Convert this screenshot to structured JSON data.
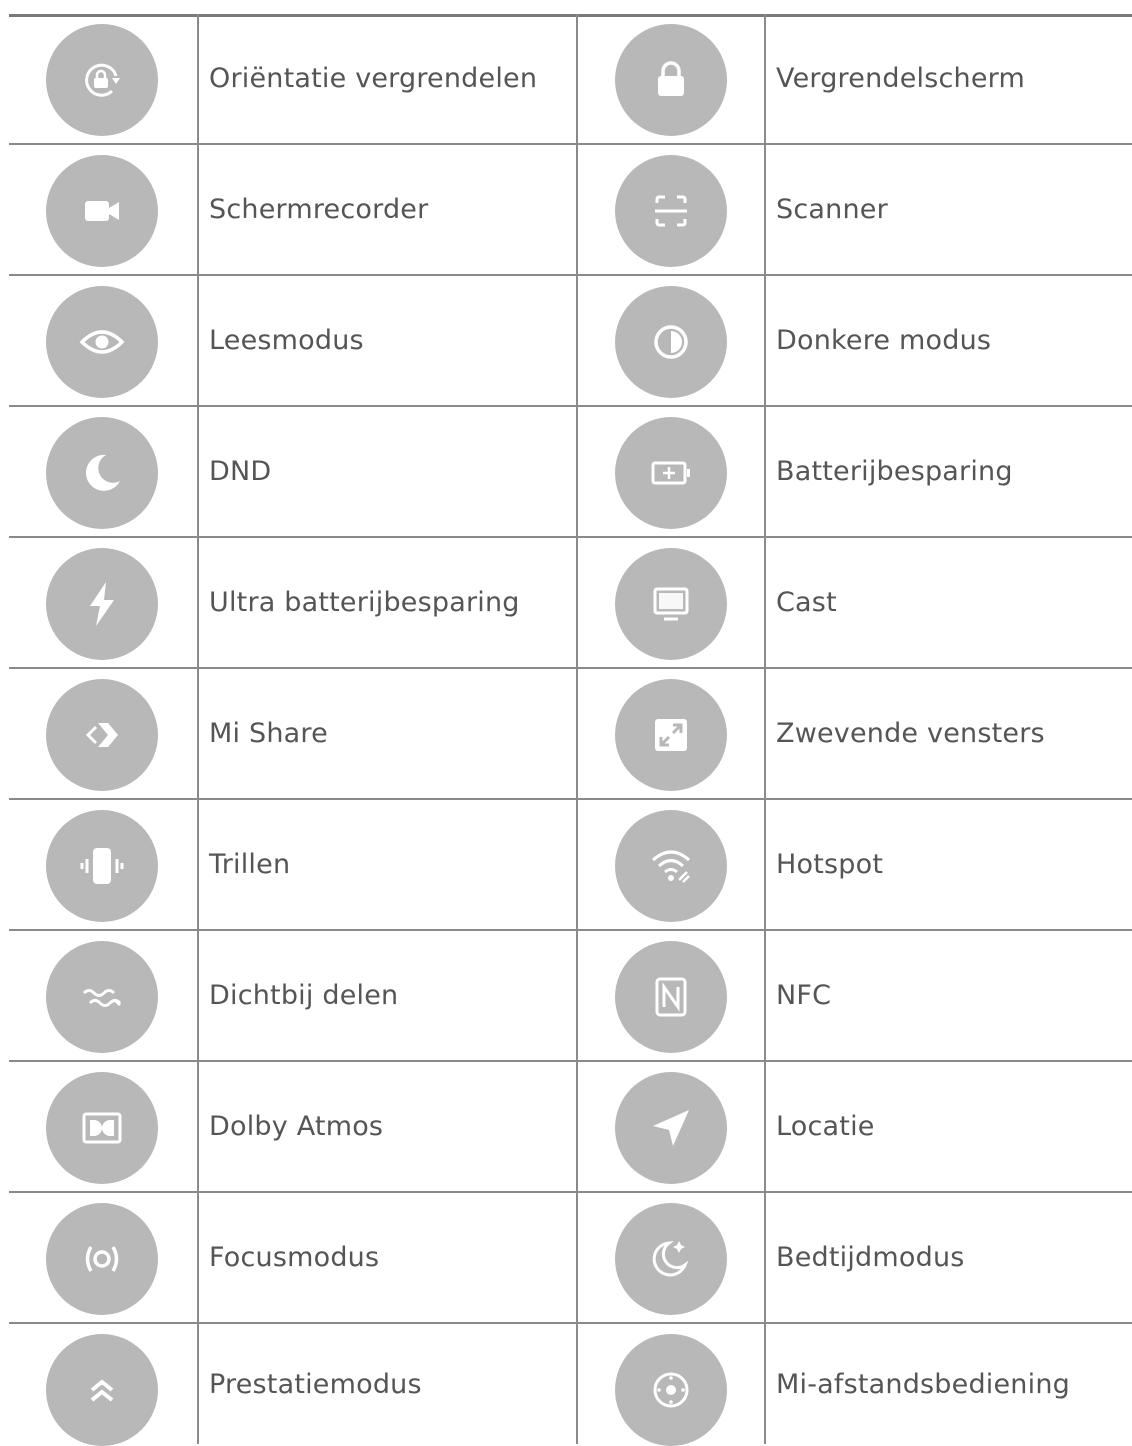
{
  "rows": [
    {
      "left": {
        "icon": "orientation-lock-icon",
        "label": "Oriëntatie vergrendelen"
      },
      "right": {
        "icon": "lock-icon",
        "label": "Vergrendelscherm"
      }
    },
    {
      "left": {
        "icon": "video-camera-icon",
        "label": "Schermrecorder"
      },
      "right": {
        "icon": "scanner-icon",
        "label": "Scanner"
      }
    },
    {
      "left": {
        "icon": "eye-icon",
        "label": "Leesmodus"
      },
      "right": {
        "icon": "dark-mode-icon",
        "label": "Donkere modus"
      }
    },
    {
      "left": {
        "icon": "moon-icon",
        "label": "DND"
      },
      "right": {
        "icon": "battery-icon",
        "label": "Batterijbesparing"
      }
    },
    {
      "left": {
        "icon": "lightning-icon",
        "label": "Ultra batterijbesparing"
      },
      "right": {
        "icon": "monitor-icon",
        "label": "Cast"
      }
    },
    {
      "left": {
        "icon": "mi-share-icon",
        "label": "Mi Share"
      },
      "right": {
        "icon": "floating-window-icon",
        "label": "Zwevende vensters"
      }
    },
    {
      "left": {
        "icon": "vibrate-icon",
        "label": "Trillen"
      },
      "right": {
        "icon": "hotspot-icon",
        "label": "Hotspot"
      }
    },
    {
      "left": {
        "icon": "nearby-share-icon",
        "label": "Dichtbij delen"
      },
      "right": {
        "icon": "nfc-icon",
        "label": "NFC"
      }
    },
    {
      "left": {
        "icon": "dolby-icon",
        "label": "Dolby Atmos"
      },
      "right": {
        "icon": "location-arrow-icon",
        "label": "Locatie"
      }
    },
    {
      "left": {
        "icon": "focus-mode-icon",
        "label": "Focusmodus"
      },
      "right": {
        "icon": "bedtime-icon",
        "label": "Bedtijdmodus"
      }
    },
    {
      "left": {
        "icon": "performance-icon",
        "label": "Prestatiemodus"
      },
      "right": {
        "icon": "remote-icon",
        "label": "Mi-afstandsbediening"
      }
    }
  ],
  "colors": {
    "circle": "#b8b8b8",
    "glyph": "#ffffff",
    "text": "#555555",
    "rule": "#8a8a8a"
  }
}
